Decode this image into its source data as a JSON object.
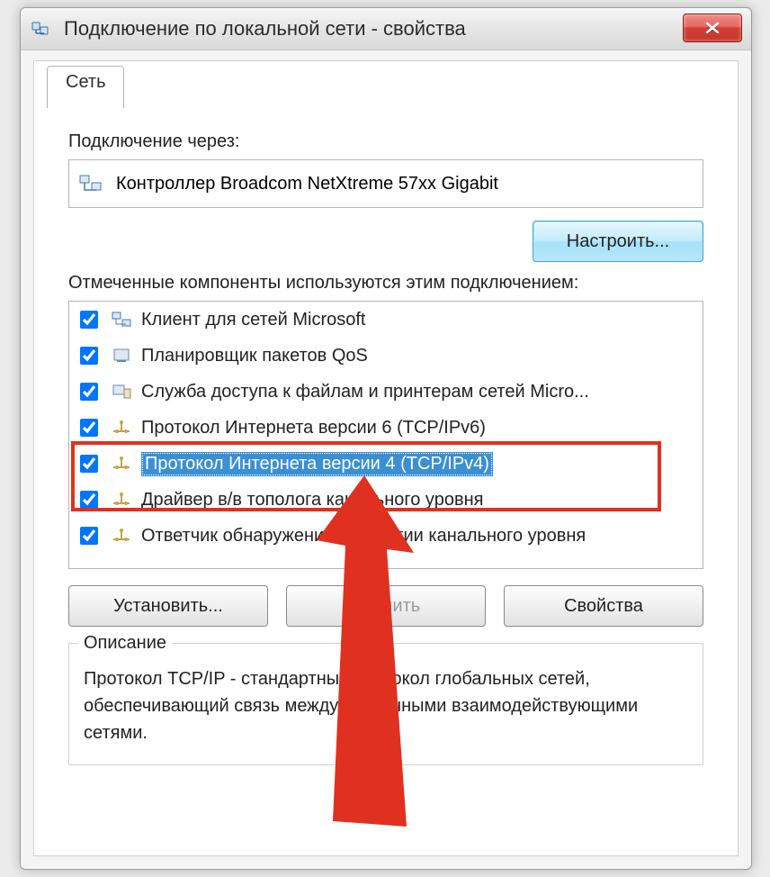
{
  "window_title": "Подключение по локальной сети - свойства",
  "tab_label": "Сеть",
  "connect_via_label": "Подключение через:",
  "device_name": "Контроллер Broadcom NetXtreme 57xx Gigabit",
  "configure_button": "Настроить...",
  "components_label": "Отмеченные компоненты используются этим подключением:",
  "items": [
    {
      "label": "Клиент для сетей Microsoft",
      "checked": true,
      "selected": false,
      "icon": "client"
    },
    {
      "label": "Планировщик пакетов QoS",
      "checked": true,
      "selected": false,
      "icon": "qos"
    },
    {
      "label": "Служба доступа к файлам и принтерам сетей Micro...",
      "checked": true,
      "selected": false,
      "icon": "share"
    },
    {
      "label": "Протокол Интернета версии 6 (TCP/IPv6)",
      "checked": true,
      "selected": false,
      "icon": "proto"
    },
    {
      "label": "Протокол Интернета версии 4 (TCP/IPv4)",
      "checked": true,
      "selected": true,
      "icon": "proto"
    },
    {
      "label": "Драйвер в/в тополога канального уровня",
      "checked": true,
      "selected": false,
      "icon": "proto"
    },
    {
      "label": "Ответчик обнаружения топологии канального уровня",
      "checked": true,
      "selected": false,
      "icon": "proto"
    }
  ],
  "install_button": "Установить...",
  "remove_button": "Удалить",
  "properties_button": "Свойства",
  "description_legend": "Описание",
  "description_text": "Протокол TCP/IP - стандартный протокол глобальных сетей, обеспечивающий связь между различными взаимодействующими сетями."
}
